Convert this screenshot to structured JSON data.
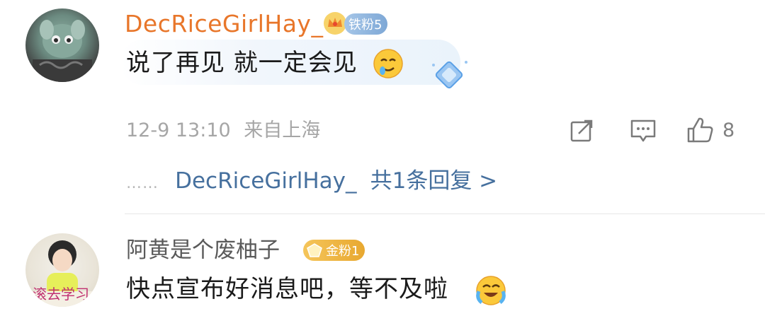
{
  "comments": [
    {
      "username": "DecRiceGirlHay_",
      "fan_badge": "铁粉5",
      "text": "说了再见 就一定会见",
      "emoji": "crying-smile-emoji",
      "timestamp": "12-9 13:10",
      "location": "来自上海",
      "like_count": "8",
      "replies": {
        "prefix": "……",
        "username": "DecRiceGirlHay_",
        "summary": "共1条回复 >"
      }
    },
    {
      "username": "阿黄是个废柚子",
      "fan_badge": "金粉1",
      "text": "快点宣布好消息吧，等不及啦",
      "emoji": "laugh-cry-emoji",
      "avatar_caption": "滚去学习"
    }
  ],
  "icons": {
    "share": "share-icon",
    "comment": "comment-icon",
    "like": "thumbs-up-icon",
    "crown": "crown-icon",
    "diamond": "diamond-icon"
  },
  "colors": {
    "username_orange": "#e8762a",
    "reply_link_blue": "#46709e",
    "meta_gray": "#a6a6a6"
  }
}
